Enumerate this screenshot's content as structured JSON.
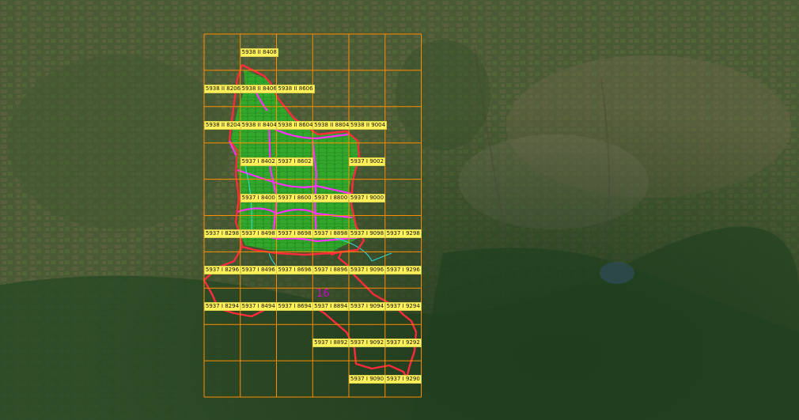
{
  "colors": {
    "grid": "#ff8c00",
    "boundary_outer": "#ff2a3a",
    "boundary_inner": "#ff30ff",
    "field_fill": "#2fb12a",
    "label_bg": "#fff15a",
    "zone_label": "#d000d0"
  },
  "sheets": [
    {
      "label": "5938 II 8408",
      "row": 0,
      "col": 1
    },
    {
      "label": "5938 II 8206",
      "row": 1,
      "col": 0
    },
    {
      "label": "5938 II 8406",
      "row": 1,
      "col": 1
    },
    {
      "label": "5938 II 8606",
      "row": 1,
      "col": 2
    },
    {
      "label": "5938 II 8204",
      "row": 2,
      "col": 0
    },
    {
      "label": "5938 II 8404",
      "row": 2,
      "col": 1
    },
    {
      "label": "5938 II 8604",
      "row": 2,
      "col": 2
    },
    {
      "label": "5938 II 8804",
      "row": 2,
      "col": 3
    },
    {
      "label": "5938 II 9004",
      "row": 2,
      "col": 4
    },
    {
      "label": "5937 I 8402",
      "row": 3,
      "col": 1
    },
    {
      "label": "5937 I 8602",
      "row": 3,
      "col": 2
    },
    {
      "label": "5937 I 9002",
      "row": 3,
      "col": 4
    },
    {
      "label": "5937 I 8400",
      "row": 4,
      "col": 1
    },
    {
      "label": "5937 I 8600",
      "row": 4,
      "col": 2
    },
    {
      "label": "5937 I 8800",
      "row": 4,
      "col": 3
    },
    {
      "label": "5937 I 9000",
      "row": 4,
      "col": 4
    },
    {
      "label": "5937 I 8298",
      "row": 5,
      "col": 0
    },
    {
      "label": "5937 I 8498",
      "row": 5,
      "col": 1
    },
    {
      "label": "5937 I 8698",
      "row": 5,
      "col": 2
    },
    {
      "label": "5937 I 8898",
      "row": 5,
      "col": 3
    },
    {
      "label": "5937 I 9098",
      "row": 5,
      "col": 4
    },
    {
      "label": "5937 I 9298",
      "row": 5,
      "col": 5
    },
    {
      "label": "5937 I 8296",
      "row": 6,
      "col": 0
    },
    {
      "label": "5937 I 8496",
      "row": 6,
      "col": 1
    },
    {
      "label": "5937 I 8696",
      "row": 6,
      "col": 2
    },
    {
      "label": "5937 I 8896",
      "row": 6,
      "col": 3
    },
    {
      "label": "5937 I 9096",
      "row": 6,
      "col": 4
    },
    {
      "label": "5937 I 9296",
      "row": 6,
      "col": 5
    },
    {
      "label": "5937 I 8294",
      "row": 7,
      "col": 0
    },
    {
      "label": "5937 I 8494",
      "row": 7,
      "col": 1
    },
    {
      "label": "5937 I 8694",
      "row": 7,
      "col": 2
    },
    {
      "label": "5937 I 8894",
      "row": 7,
      "col": 3
    },
    {
      "label": "5937 I 9094",
      "row": 7,
      "col": 4
    },
    {
      "label": "5937 I 9294",
      "row": 7,
      "col": 5
    },
    {
      "label": "5937 I 8892",
      "row": 8,
      "col": 3
    },
    {
      "label": "5937 I 9092",
      "row": 8,
      "col": 4
    },
    {
      "label": "5937 I 9292",
      "row": 8,
      "col": 5
    },
    {
      "label": "5937 I 9090",
      "row": 9,
      "col": 4
    },
    {
      "label": "5937 I 9290",
      "row": 9,
      "col": 5
    }
  ],
  "zone_labels": [
    {
      "text": "16"
    }
  ]
}
